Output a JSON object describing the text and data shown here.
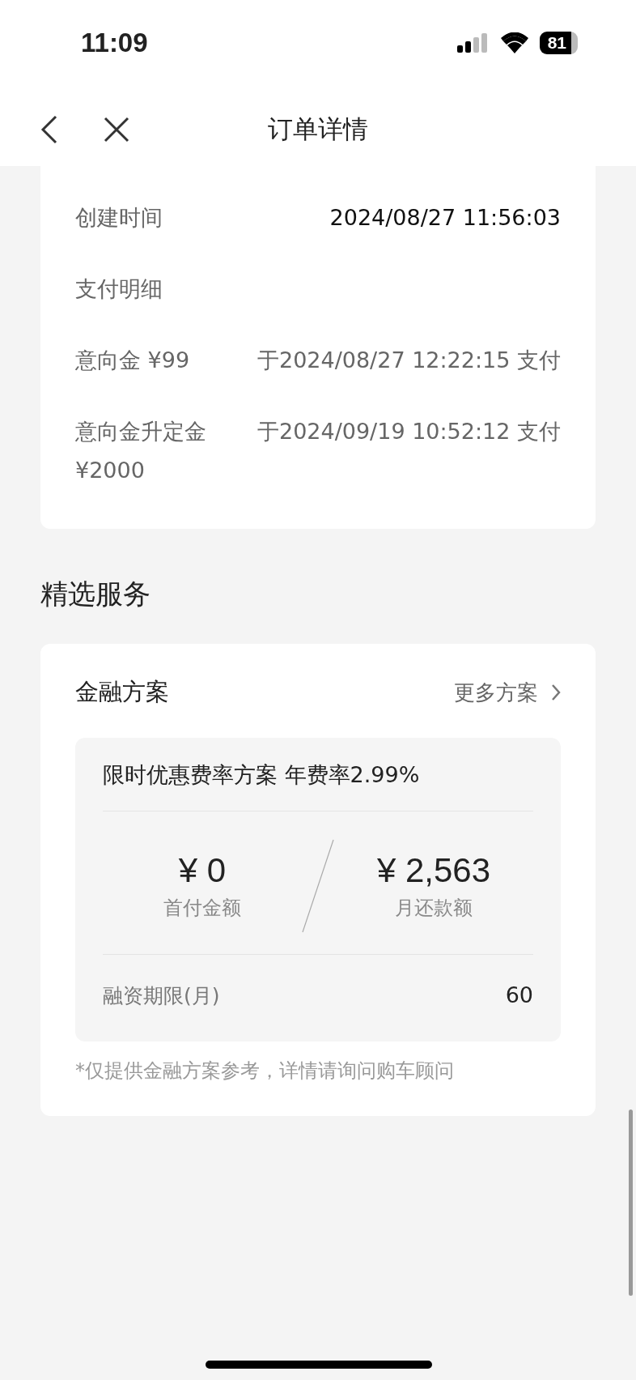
{
  "status_bar": {
    "time": "11:09",
    "battery": "81"
  },
  "nav": {
    "title": "订单详情"
  },
  "order_info": {
    "rows": [
      {
        "label": "创建时间",
        "value": "2024/08/27 11:56:03"
      }
    ],
    "payment_title": "支付明细",
    "payments": [
      {
        "label": "意向金 ¥99",
        "value": "于2024/08/27 12:22:15 支付"
      },
      {
        "label": "意向金升定金 ¥2000",
        "value": "于2024/09/19 10:52:12 支付"
      }
    ]
  },
  "section_title": "精选服务",
  "finance": {
    "title": "金融方案",
    "more": "更多方案",
    "plan": {
      "name": "限时优惠费率方案 年费率2.99%",
      "amounts": [
        {
          "value": "¥ 0",
          "label": "首付金额"
        },
        {
          "value": "¥ 2,563",
          "label": "月还款额"
        }
      ],
      "term_label": "融资期限(月)",
      "term_value": "60"
    },
    "note": "*仅提供金融方案参考，详情请询问购车顾问"
  }
}
